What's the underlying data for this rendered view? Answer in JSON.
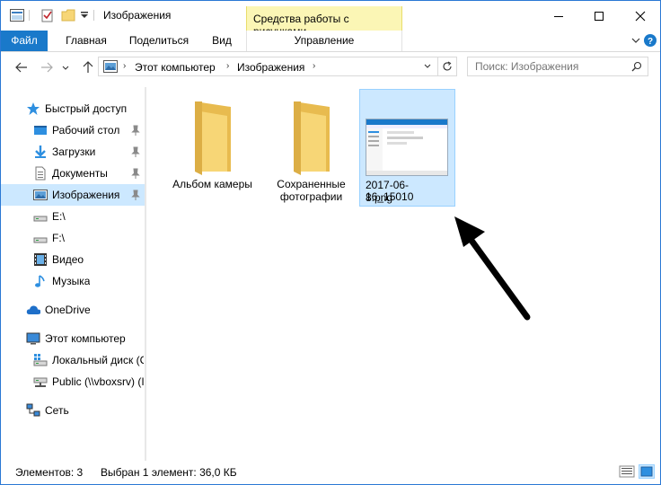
{
  "window": {
    "title": "Изображения"
  },
  "ribbon": {
    "context_group": "Средства работы с рисунками",
    "tabs": {
      "file": "Файл",
      "home": "Главная",
      "share": "Поделиться",
      "view": "Вид",
      "manage": "Управление"
    }
  },
  "address": {
    "crumbs": [
      "Этот компьютер",
      "Изображения"
    ]
  },
  "search": {
    "placeholder": "Поиск: Изображения"
  },
  "nav": {
    "quick_access": "Быстрый доступ",
    "items": [
      "Рабочий стол",
      "Загрузки",
      "Документы",
      "Изображения",
      "E:\\",
      "F:\\",
      "Видео",
      "Музыка"
    ],
    "onedrive": "OneDrive",
    "this_pc": "Этот компьютер",
    "drives": [
      "Локальный диск (C",
      "Public (\\\\vboxsrv) (I"
    ],
    "network": "Сеть"
  },
  "content": {
    "items": [
      {
        "label": "Альбом камеры",
        "type": "folder"
      },
      {
        "label": "Сохраненные фотографии",
        "type": "folder"
      },
      {
        "label": "2017-06-16_150108.png",
        "type": "image"
      }
    ],
    "file_label_lines": [
      "2017-06-16_15010",
      "8.png"
    ],
    "folder2_lines": [
      "Сохраненные",
      "фотографии"
    ]
  },
  "status": {
    "count": "Элементов: 3",
    "selected": "Выбран 1 элемент: 36,0 КБ"
  },
  "colors": {
    "accent": "#1979ca",
    "selection": "#cce8ff",
    "context_tab": "#fbf6b5",
    "folder": "#f7d676"
  }
}
